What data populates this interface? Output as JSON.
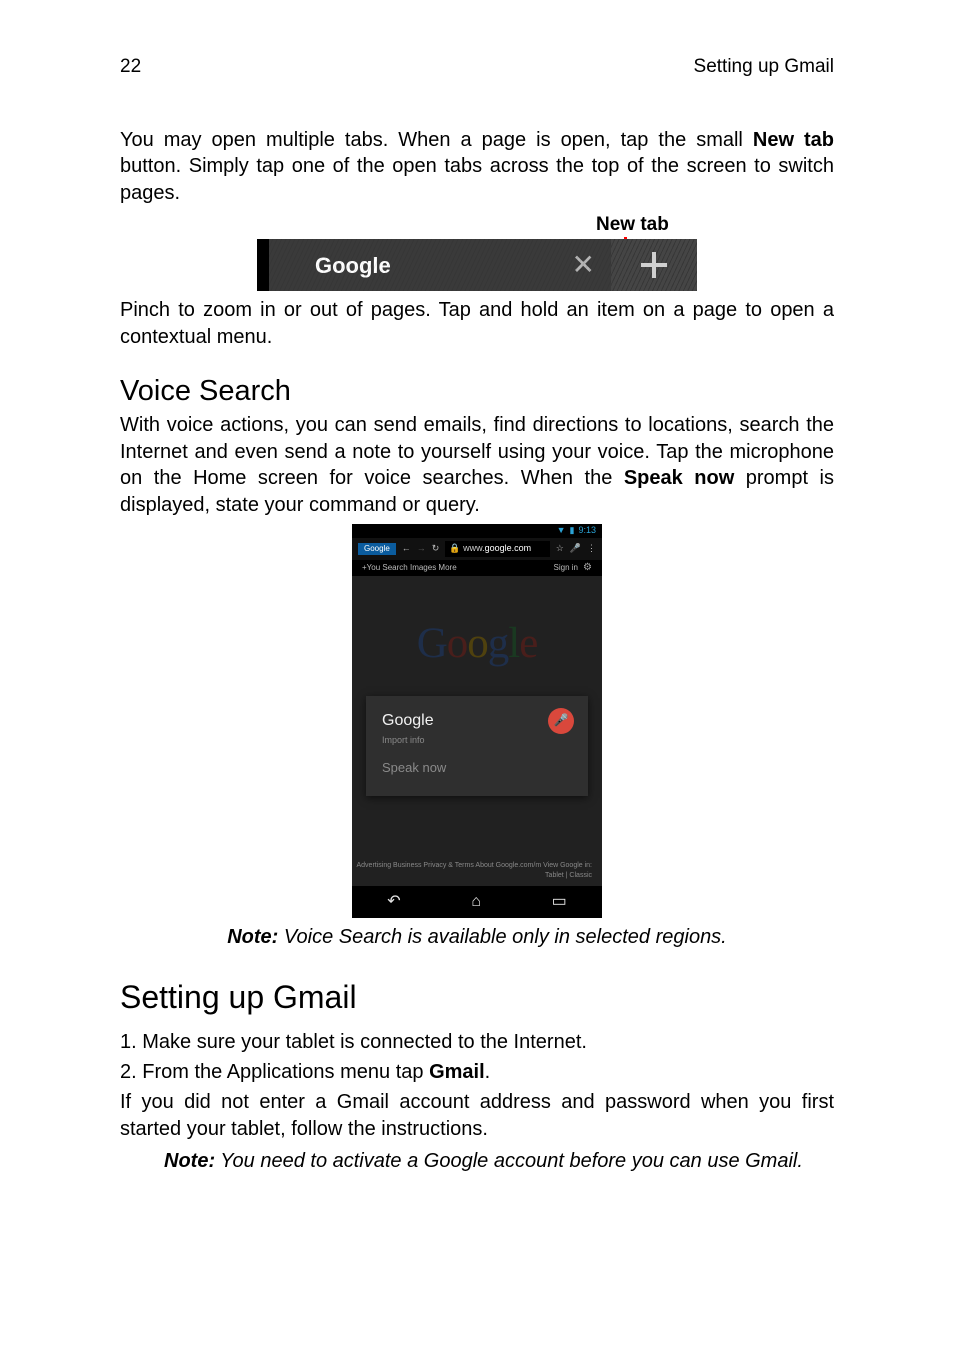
{
  "header": {
    "page_number": "22",
    "running_head": "Setting up Gmail"
  },
  "intro_para_pre": "You may open multiple tabs. When a page is open, tap the small ",
  "intro_para_bold": "New tab",
  "intro_para_post": " button. Simply tap one of the open tabs across the top of the screen to switch pages.",
  "newtab_label": "New tab",
  "tabstrip": {
    "tab_title": "Google",
    "close_glyph": "✕",
    "plus_glyph": "+"
  },
  "pinch_para": "Pinch to zoom in or out of pages. Tap and hold an item on a page to open a contextual menu.",
  "voice_heading": "Voice Search",
  "voice_para_pre": "With voice actions, you can send emails, find directions to locations, search the Internet and even send a note to yourself using your voice. Tap the microphone on the Home screen for voice searches. When the ",
  "voice_para_bold": "Speak now",
  "voice_para_post": " prompt is displayed, state your command or query.",
  "mock": {
    "status_time": "9:13",
    "tab_chip": "Google",
    "url_pre": "www.",
    "url_bold": "google.com",
    "topbar_left": "+You   Search   Images   More",
    "signin": "Sign in",
    "logo_letters": [
      "G",
      "o",
      "o",
      "g",
      "l",
      "e"
    ],
    "card_title": "Google",
    "card_sub": "Import info",
    "speak_now": "Speak now",
    "footer_text": "Advertising    Business    Privacy & Terms    About    Google.com/m    View Google in: Tablet | Classic",
    "nav": {
      "back": "↶",
      "home": "⌂",
      "recent": "▭"
    }
  },
  "voice_note_bold": "Note:",
  "voice_note_rest": " Voice Search is available only in selected regions.",
  "gmail_heading": "Setting up Gmail",
  "gmail_step1": "1. Make sure your tablet is connected to the Internet.",
  "gmail_step2_pre": "2. From the Applications menu tap ",
  "gmail_step2_bold": "Gmail",
  "gmail_step2_post": ".",
  "gmail_para": "If you did not enter a Gmail account address and password when you first started your tablet, follow the instructions.",
  "gmail_note_bold": "Note:",
  "gmail_note_rest": " You need to activate a Google account before you can use Gmail."
}
